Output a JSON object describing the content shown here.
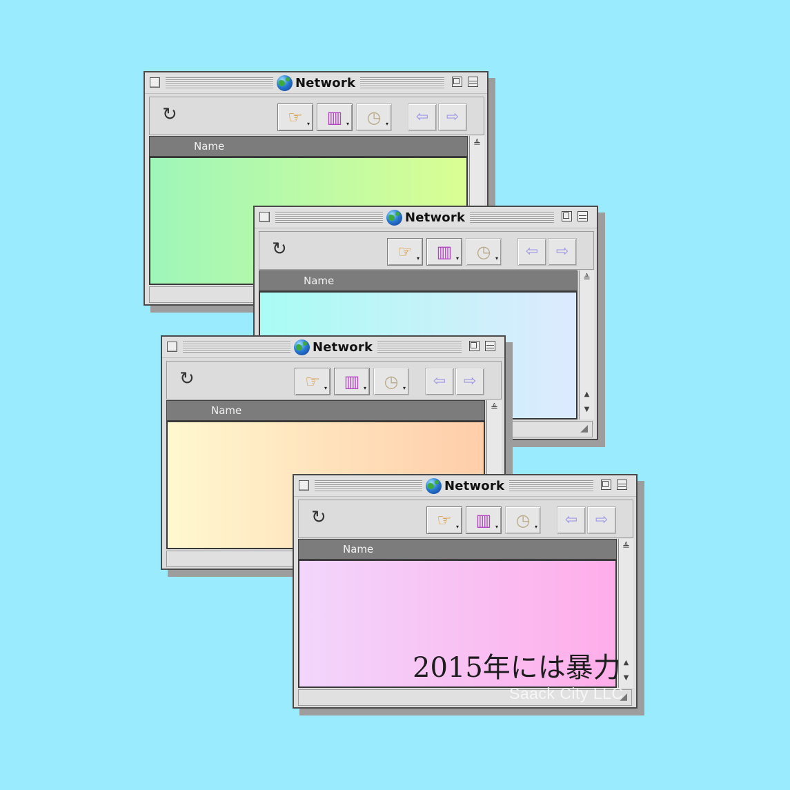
{
  "colors": {
    "desktop_background": "#9aebfd",
    "window_gradients": [
      [
        "#9ef6b9",
        "#dafe93"
      ],
      [
        "#a9fcf4",
        "#ddeafe"
      ],
      [
        "#fff8cf",
        "#ffcdaa"
      ],
      [
        "#f2d6fc",
        "#ffadea"
      ]
    ]
  },
  "windows": [
    {
      "title": "Network",
      "column_header": "Name"
    },
    {
      "title": "Network",
      "column_header": "Name"
    },
    {
      "title": "Network",
      "column_header": "Name"
    },
    {
      "title": "Network",
      "column_header": "Name"
    }
  ],
  "icons": {
    "title": "globe-icon",
    "toolbar": [
      "refresh-icon",
      "pointing-hand-icon",
      "favorites-icon",
      "history-clock-icon",
      "back-arrow-icon",
      "forward-arrow-icon"
    ],
    "refresh": "↻",
    "pointer": "☞",
    "favorites": "▥",
    "history": "◷",
    "back": "⇦",
    "forward": "⇨",
    "sort": "≜",
    "scroll_up": "▲",
    "scroll_down": "▼",
    "caret": "▾",
    "grow": "◢"
  },
  "caption": "2015年には暴力",
  "watermark": "Saack City LLC"
}
